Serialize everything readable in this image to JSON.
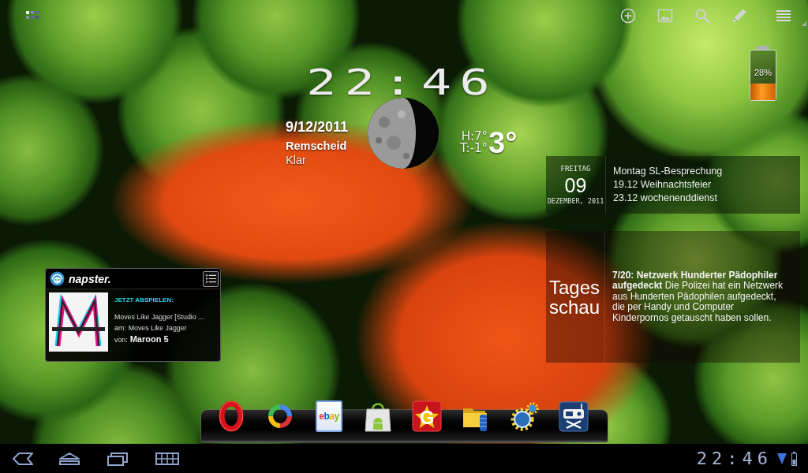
{
  "clock_widget": {
    "time": "22:46",
    "date": "9/12/2011",
    "city": "Remscheid",
    "condition": "Klar",
    "high": "H:7°",
    "low": "T:-1°",
    "temperature": "3°"
  },
  "battery_widget": {
    "level": 0.33,
    "reading": "28%"
  },
  "calendar_widget": {
    "weekday": "FREITAG",
    "day": "09",
    "month_year": "DEZEMBER, 2011",
    "events": [
      "Montag SL-Besprechung",
      "19.12 Weihnachtsfeier",
      "23.12 wochenenddienst"
    ]
  },
  "music_widget": {
    "brand": "napster.",
    "heading": "JETZT ABSPIELEN:",
    "title": "Moves Like Jagger [Studio ...",
    "album_label": "am:",
    "album": "Moves Like Jagger",
    "artist_label": "von:",
    "artist": "Maroon 5"
  },
  "news_widget": {
    "source": "Tages schau",
    "text": "**7/20: Netzwerk Hunderter Pädophiler aufgedeckt** Die Polizei hat ein Netzwerk aus Hunderten Pädophilen aufgedeckt, die per Handy und Computer Kinderpornos getauscht haben sollen."
  },
  "dock": [
    {
      "kind": "ring"
    },
    {
      "kind": "swirl"
    },
    {
      "kind": "tile",
      "text": "ebay"
    },
    {
      "kind": "bag"
    },
    {
      "kind": "star",
      "text": "G"
    },
    {
      "kind": "folder"
    },
    {
      "kind": "gears"
    },
    {
      "kind": "radio"
    }
  ],
  "navigation_bar": {
    "time": "22:46"
  }
}
